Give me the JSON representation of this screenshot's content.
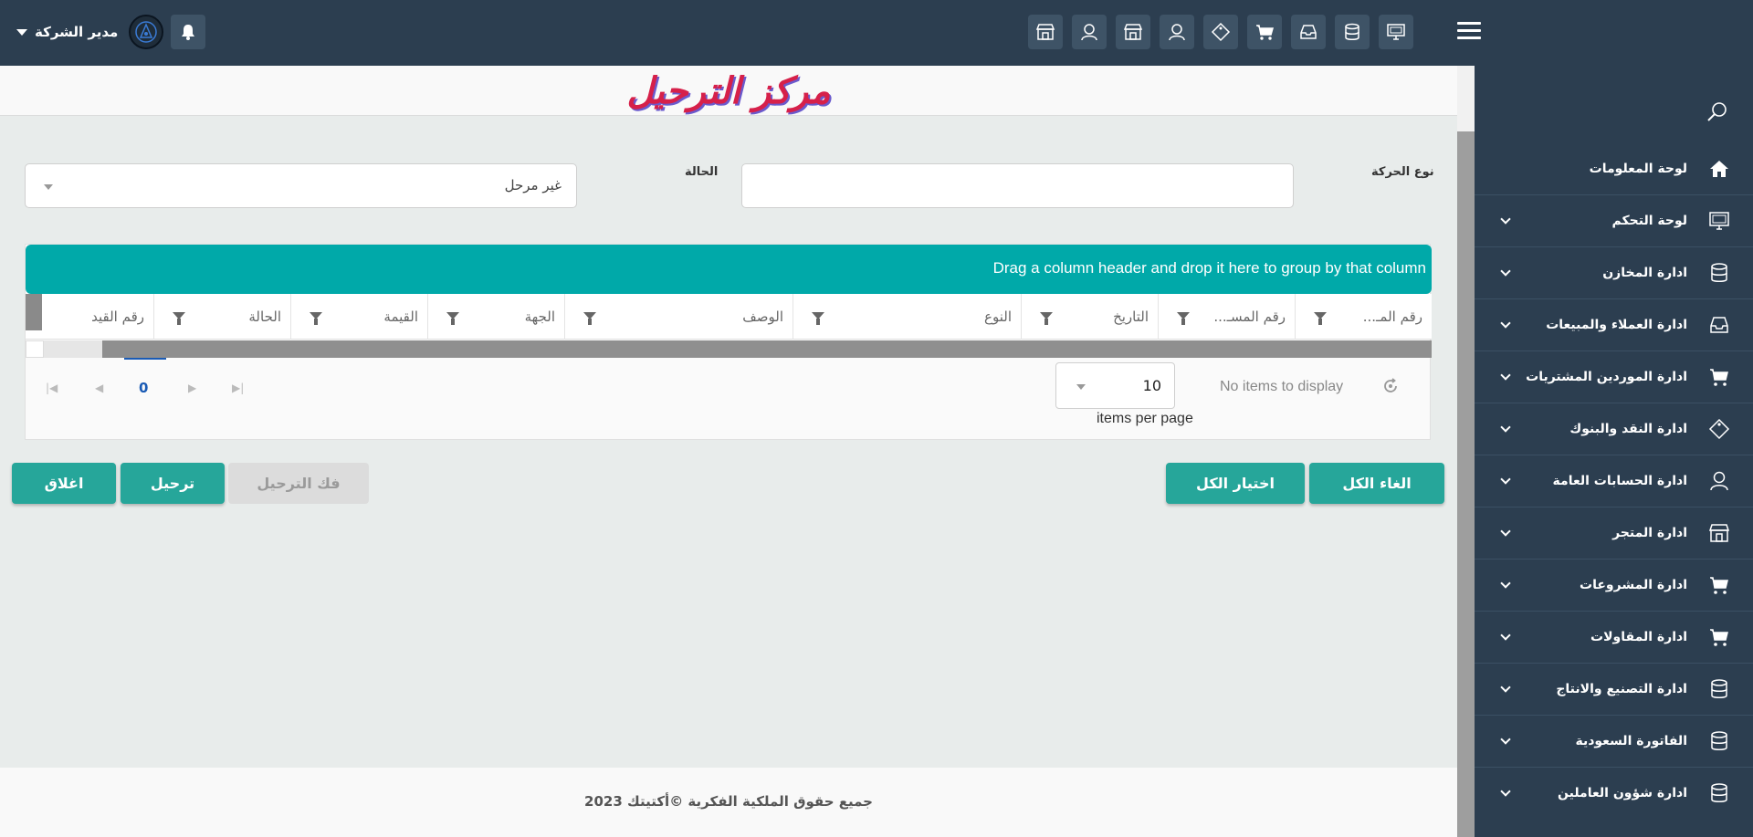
{
  "header": {
    "user_name": "مدير الشركة",
    "top_icons": [
      "store-icon",
      "user-icon",
      "store-icon",
      "user-icon",
      "tag-icon",
      "cart-icon",
      "inbox-icon",
      "database-icon",
      "monitor-icon"
    ]
  },
  "sidebar": {
    "items": [
      {
        "label": "لوحة المعلومات",
        "icon": "home-icon",
        "expandable": false
      },
      {
        "label": "لوحة التحكم",
        "icon": "monitor-icon",
        "expandable": true
      },
      {
        "label": "ادارة المخازن",
        "icon": "database-icon",
        "expandable": true
      },
      {
        "label": "ادارة العملاء والمبيعات",
        "icon": "inbox-icon",
        "expandable": true
      },
      {
        "label": "ادارة الموردين المشتريات",
        "icon": "cart-icon",
        "expandable": true
      },
      {
        "label": "ادارة النقد والبنوك",
        "icon": "tag-icon",
        "expandable": true
      },
      {
        "label": "ادارة الحسابات العامة",
        "icon": "user-icon",
        "expandable": true
      },
      {
        "label": "ادارة المتجر",
        "icon": "store-icon",
        "expandable": true
      },
      {
        "label": "ادارة المشروعات",
        "icon": "cart-icon",
        "expandable": true
      },
      {
        "label": "ادارة المقاولات",
        "icon": "cart-icon",
        "expandable": true
      },
      {
        "label": "ادارة التصنيع والانتاج",
        "icon": "database-icon",
        "expandable": true
      },
      {
        "label": "الفاتورة السعودية",
        "icon": "database-icon",
        "expandable": true
      },
      {
        "label": "ادارة شؤون العاملين",
        "icon": "database-icon",
        "expandable": true
      }
    ]
  },
  "page": {
    "title": "مركز الترحيل"
  },
  "filters": {
    "movement_type_label": "نوع الحركة",
    "movement_type_value": "",
    "status_label": "الحالة",
    "status_value": "غير مرحل"
  },
  "grid": {
    "group_hint": "Drag a column header and drop it here to group by that column",
    "columns": [
      "رقم المـ...",
      "رقم المسـ...",
      "التاريخ",
      "النوع",
      "الوصف",
      "الجهة",
      "القيمة",
      "الحالة",
      "رقم القيد"
    ],
    "rows": [],
    "pager": {
      "current_page": "0",
      "page_size": "10",
      "items_per_page_label": "items per page",
      "status": "No items to display"
    }
  },
  "actions": {
    "deselect_all": "الغاء الكل",
    "select_all": "اختيار الكل",
    "unpost": "فك الترحيل",
    "post": "ترحيل",
    "close": "اغلاق"
  },
  "footer": {
    "copyright": "جميع حقوق الملكية الفكرية ©أكتيتك 2023"
  },
  "colors": {
    "topbar": "#2c3e50",
    "accent_teal": "#00a9a9",
    "button_teal": "#26a69a",
    "title_red": "#d6204a"
  }
}
